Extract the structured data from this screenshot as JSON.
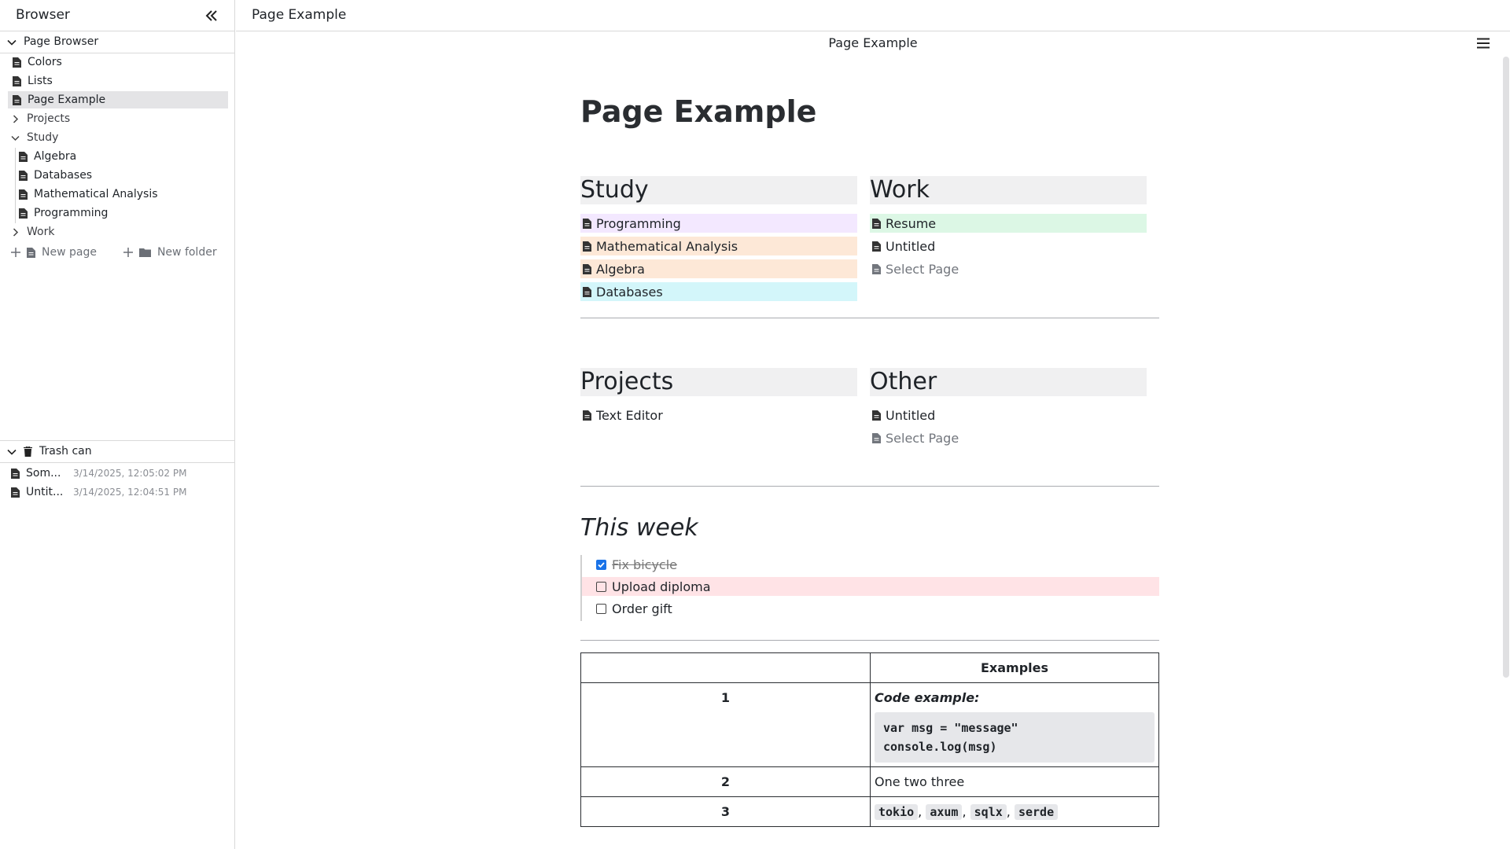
{
  "sidebar": {
    "title": "Browser",
    "page_browser_label": "Page Browser",
    "items": [
      {
        "label": "Colors"
      },
      {
        "label": "Lists"
      },
      {
        "label": "Page Example"
      },
      {
        "label": "Projects"
      },
      {
        "label": "Study"
      },
      {
        "label": "Algebra"
      },
      {
        "label": "Databases"
      },
      {
        "label": "Mathematical Analysis"
      },
      {
        "label": "Programming"
      },
      {
        "label": "Work"
      }
    ],
    "new_page_label": "New page",
    "new_folder_label": "New folder",
    "trash": {
      "label": "Trash can",
      "items": [
        {
          "name": "Som...",
          "time": "3/14/2025, 12:05:02 PM"
        },
        {
          "name": "Untit...",
          "time": "3/14/2025, 12:04:51 PM"
        }
      ]
    }
  },
  "topbar": {
    "title": "Page Example"
  },
  "doc": {
    "header_title": "Page Example",
    "title": "Page Example",
    "panels": [
      {
        "title": "Study",
        "items": [
          {
            "label": "Programming",
            "color": "#f3e8ff"
          },
          {
            "label": "Mathematical Analysis",
            "color": "#fde8d7"
          },
          {
            "label": "Algebra",
            "color": "#fde8d7"
          },
          {
            "label": "Databases",
            "color": "#d3f6fa"
          }
        ]
      },
      {
        "title": "Work",
        "items": [
          {
            "label": "Resume",
            "color": "#dcf7e5"
          },
          {
            "label": "Untitled"
          },
          {
            "label": "Select Page"
          }
        ]
      },
      {
        "title": "Projects",
        "items": [
          {
            "label": "Text Editor"
          }
        ]
      },
      {
        "title": "Other",
        "items": [
          {
            "label": "Untitled"
          },
          {
            "label": "Select Page"
          }
        ]
      }
    ],
    "week": {
      "title": "This week",
      "tasks": [
        {
          "label": "Fix bicycle",
          "done": true
        },
        {
          "label": "Upload diploma",
          "done": false,
          "highlight": "#ffe3e6"
        },
        {
          "label": "Order gift",
          "done": false
        }
      ]
    },
    "table": {
      "header": [
        "",
        "Examples"
      ],
      "rows": [
        {
          "num": "1",
          "code_label": "Code example:",
          "code_line1": "var msg = \"message\"",
          "code_line2": "console.log(msg)"
        },
        {
          "num": "2",
          "text": "One two three"
        },
        {
          "num": "3",
          "chips": [
            "tokio",
            "axum",
            "sqlx",
            "serde"
          ],
          "separator": ","
        }
      ]
    }
  }
}
